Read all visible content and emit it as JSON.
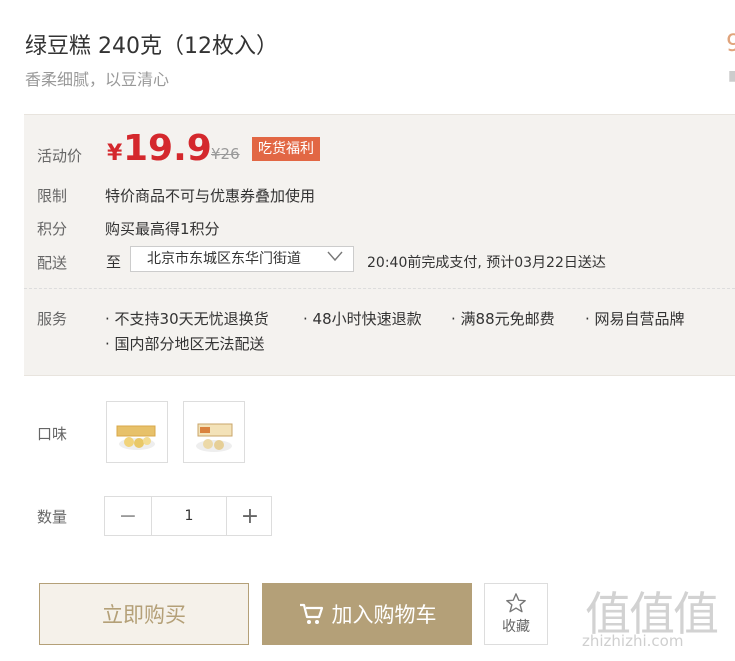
{
  "product": {
    "title": "绿豆糕 240克（12枚入）",
    "subtitle": "香柔细腻，以豆清心"
  },
  "edge": {
    "cut_text": "9"
  },
  "price": {
    "label": "活动价",
    "currency": "¥",
    "value": "19.9",
    "original": "¥26",
    "tag": "吃货福利"
  },
  "limit": {
    "label": "限制",
    "text": "特价商品不可与优惠券叠加使用"
  },
  "points": {
    "label": "积分",
    "text": "购买最高得1积分"
  },
  "delivery": {
    "label": "配送",
    "to": "至",
    "address": "北京市东城区东华门街道",
    "eta": "20:40前完成支付, 预计03月22日送达"
  },
  "service": {
    "label": "服务",
    "items": [
      "不支持30天无忧退换货",
      "48小时快速退款",
      "满88元免邮费",
      "网易自营品牌",
      "国内部分地区无法配送"
    ]
  },
  "flavor": {
    "label": "口味"
  },
  "quantity": {
    "label": "数量",
    "value": "1",
    "minus": "−",
    "plus": "+"
  },
  "actions": {
    "buy_now": "立即购买",
    "add_to_cart": "加入购物车",
    "favorite": "收藏"
  },
  "watermark": {
    "text": "值值值",
    "url": "zhizhizhi.com"
  },
  "colors": {
    "price": "#d4282d",
    "accent": "#b4a078",
    "tag": "#e26744",
    "panel": "#f4f2ef"
  }
}
